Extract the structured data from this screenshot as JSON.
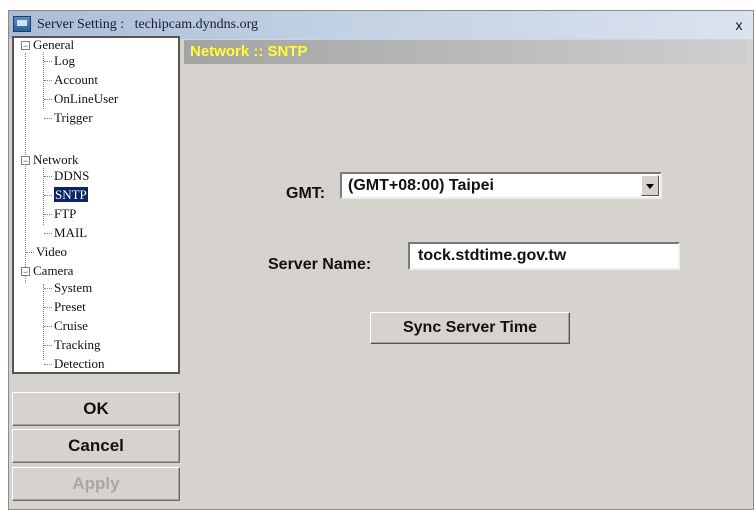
{
  "window": {
    "title": "Server Setting :   techipcam.dyndns.org",
    "close_label": "x"
  },
  "tree": {
    "general": {
      "label": "General",
      "children": [
        "Log",
        "Account",
        "OnLineUser",
        "Trigger"
      ]
    },
    "network": {
      "label": "Network",
      "children": [
        "DDNS",
        "SNTP",
        "FTP",
        "MAIL"
      ]
    },
    "video": {
      "label": "Video"
    },
    "camera": {
      "label": "Camera",
      "children": [
        "System",
        "Preset",
        "Cruise",
        "Tracking",
        "Detection"
      ]
    },
    "selected": "SNTP",
    "expander_symbol": "−"
  },
  "buttons": {
    "ok": "OK",
    "cancel": "Cancel",
    "apply": "Apply"
  },
  "panel": {
    "header": "Network :: SNTP",
    "gmt_label": "GMT:",
    "gmt_value": "(GMT+08:00) Taipei",
    "server_name_label": "Server Name:",
    "server_name_value": "tock.stdtime.gov.tw",
    "sync_button": "Sync Server Time"
  },
  "colors": {
    "header_text": "#ffff33",
    "selection": "#0a246a"
  }
}
